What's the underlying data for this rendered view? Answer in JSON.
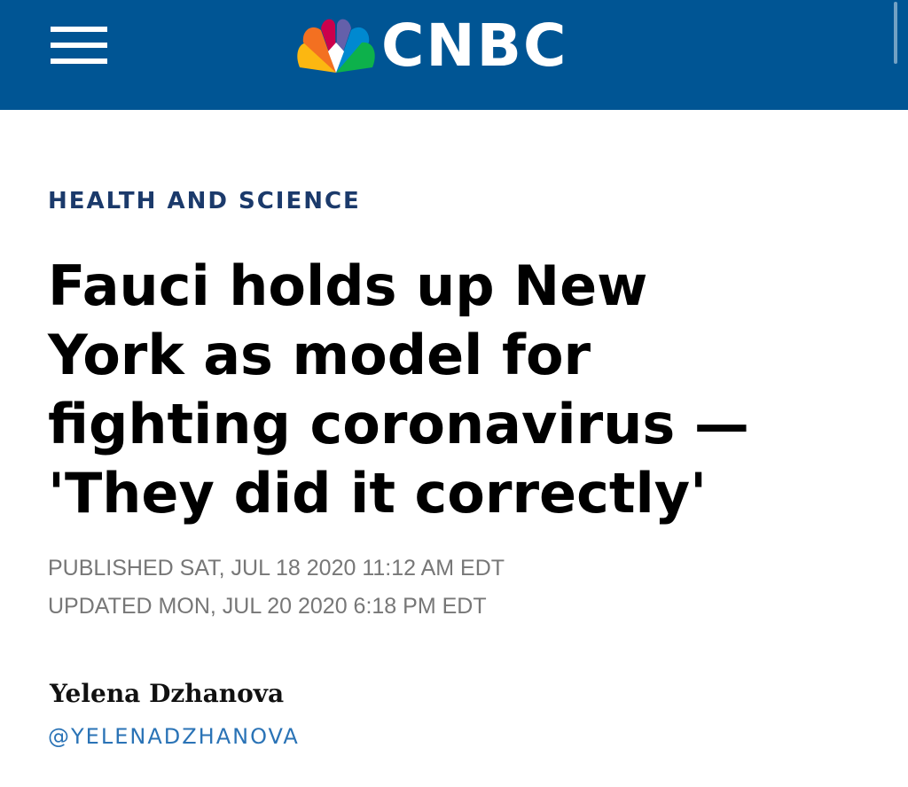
{
  "header": {
    "menu_icon": "hamburger-menu-icon",
    "logo_icon": "nbc-peacock-icon",
    "brand_name": "CNBC",
    "background_color": "#005594"
  },
  "article": {
    "section": "HEALTH AND SCIENCE",
    "headline_lines": [
      "Fauci holds up New",
      "York as model for",
      "fighting coronavirus —",
      "'They did it correctly'"
    ],
    "published": "PUBLISHED SAT, JUL 18 2020 11:12 AM EDT",
    "updated": "UPDATED MON, JUL 20 2020 6:18 PM EDT",
    "author": {
      "name": "Yelena Dzhanova",
      "handle": "@YELENADZHANOVA"
    }
  },
  "colors": {
    "section": "#1b3a6b",
    "handle": "#2a73b6",
    "dateline": "#777777",
    "peacock": [
      "#f37021",
      "#cc004c",
      "#6460aa",
      "#0089d0",
      "#0db14b",
      "#fcb711"
    ]
  }
}
